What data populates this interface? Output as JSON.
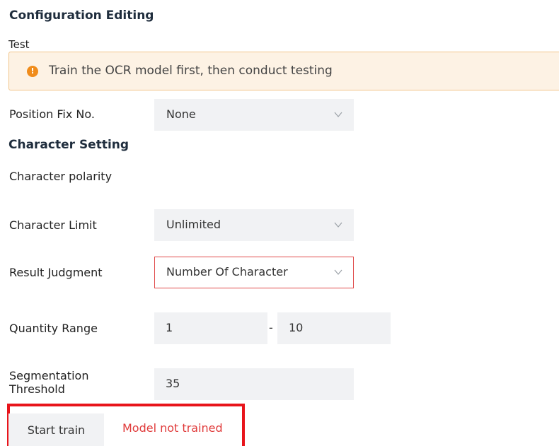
{
  "section": {
    "title": "Configuration Editing"
  },
  "test": {
    "label": "Test",
    "alert_text": "Train the OCR model first, then conduct testing",
    "alert_icon": "warning-icon",
    "alert_icon_glyph": "!"
  },
  "position_fix": {
    "label": "Position Fix No.",
    "value": "None"
  },
  "character_setting": {
    "title": "Character Setting",
    "polarity_label": "Character polarity",
    "limit": {
      "label": "Character Limit",
      "value": "Unlimited"
    },
    "result_judgment": {
      "label": "Result Judgment",
      "value": "Number Of Character"
    },
    "quantity_range": {
      "label": "Quantity Range",
      "min": "1",
      "separator": "-",
      "max": "10"
    },
    "segmentation": {
      "label_line1": "Segmentation",
      "label_line2": "Threshold",
      "value": "35"
    }
  },
  "training": {
    "button_label": "Start train",
    "status_text": "Model not trained"
  },
  "colors": {
    "alert_bg": "#fdf2e4",
    "alert_border": "#f2c48a",
    "alert_icon": "#f08c1b",
    "error_red": "#e03a3a",
    "highlight_red": "#e8141b",
    "field_bg": "#f1f2f4"
  }
}
